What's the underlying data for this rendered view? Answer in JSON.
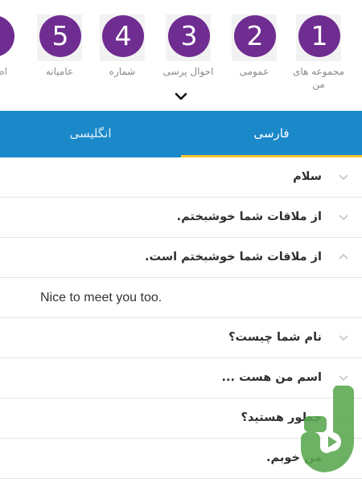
{
  "categories": [
    {
      "number": "1",
      "label_line1": "مجموعه های",
      "label_line2": "من"
    },
    {
      "number": "2",
      "label_line1": "عمومی",
      "label_line2": ""
    },
    {
      "number": "3",
      "label_line1": "احوال پرسی",
      "label_line2": ""
    },
    {
      "number": "4",
      "label_line1": "شماره",
      "label_line2": ""
    },
    {
      "number": "5",
      "label_line1": "عامیانه",
      "label_line2": ""
    },
    {
      "number": "",
      "label_line1": "اض",
      "label_line2": ""
    }
  ],
  "tabs": [
    {
      "label": "فارسی",
      "active": true
    },
    {
      "label": "انگلیسی",
      "active": false
    }
  ],
  "phrases": [
    {
      "text": "سلام",
      "expanded": false
    },
    {
      "text": "از ملاقات شما خوشبختم.",
      "expanded": false
    },
    {
      "text": "از ملاقات شما خوشبختم است.",
      "expanded": true
    },
    {
      "text": "Nice to meet you too.",
      "translation": true
    },
    {
      "text": "نام شما چیست؟",
      "expanded": false
    },
    {
      "text": "اسم من هست ...",
      "expanded": false
    },
    {
      "text": "چطور هستید؟",
      "expanded": false
    },
    {
      "text": "من خوبم.",
      "expanded": false
    }
  ],
  "colors": {
    "primary_purple": "#6f2c91",
    "tab_bar_blue": "#1a88c9",
    "tab_indicator_yellow": "#f3c535",
    "logo_green": "#5aa84f"
  },
  "icons": {
    "expand_toggle": "chevron-down-icon",
    "row_collapsed": "chevron-down-icon",
    "row_expanded": "chevron-up-icon",
    "logo": "app-logo-icon"
  }
}
